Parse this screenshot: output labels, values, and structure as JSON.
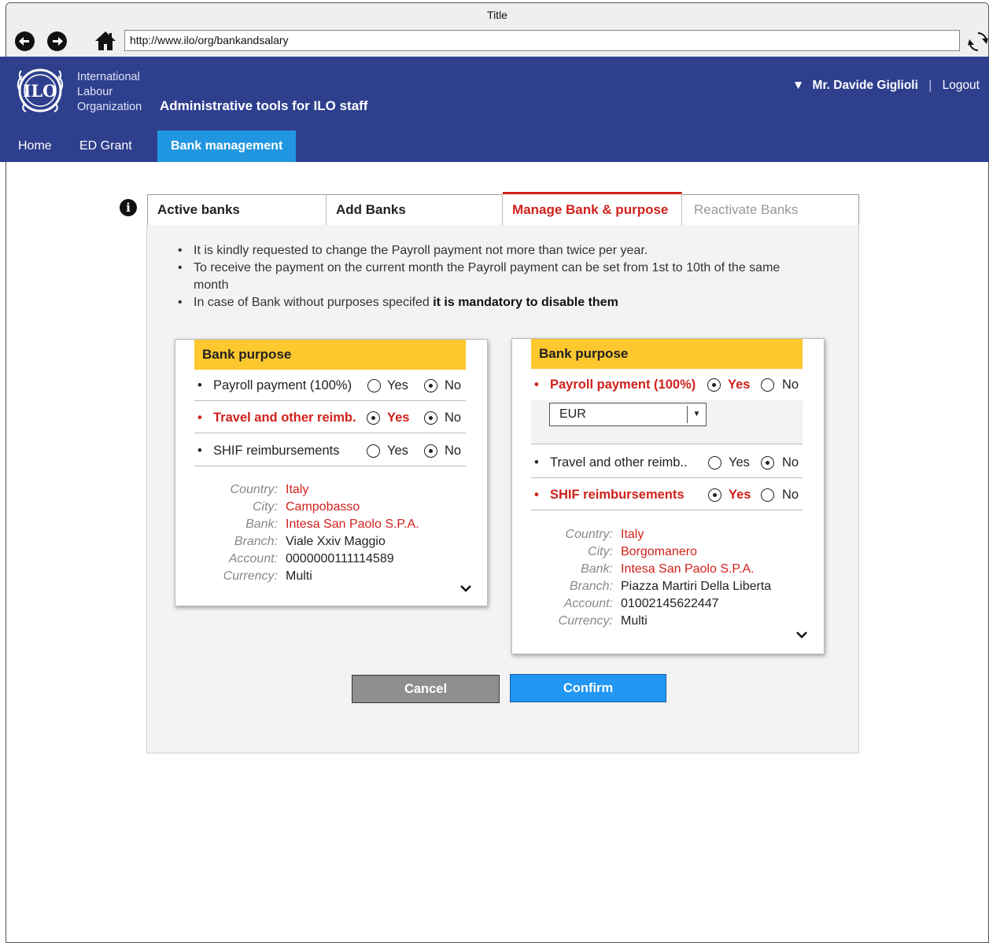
{
  "browser": {
    "title": "Title",
    "url": "http://www.ilo/org/bankandsalary"
  },
  "header": {
    "org_line1": "International",
    "org_line2": "Labour",
    "org_line3": "Organization",
    "app_title": "Administrative tools for ILO staff",
    "user_caret": "▼",
    "user_name": "Mr. Davide Giglioli",
    "separator": "|",
    "logout": "Logout"
  },
  "menu": {
    "home": "Home",
    "ed_grant": "ED Grant",
    "bank_management": "Bank management"
  },
  "tabs": {
    "active_banks": "Active banks",
    "add_banks": "Add Banks",
    "manage": "Manage Bank & purpose",
    "reactivate": "Reactivate Banks"
  },
  "notes": {
    "n1": "It is kindly requested to change the Payroll payment not more than twice per year.",
    "n2": "To receive the payment on the current month the Payroll payment can be set from 1st to 10th of the same month",
    "n3_prefix": "In case of Bank without purposes specifed ",
    "n3_strong": "it is mandatory to disable them"
  },
  "left_card": {
    "head": "Bank purpose",
    "rows": [
      {
        "label": "Payroll payment (100%)",
        "yes": "Yes",
        "no": "No",
        "selected": "no"
      },
      {
        "label": "Travel and other reimb.",
        "yes": "Yes",
        "no": "No",
        "selected": "yes"
      },
      {
        "label": "SHIF reimbursements",
        "yes": "Yes",
        "no": "No",
        "selected": "no"
      }
    ],
    "details": {
      "country_label": "Country:",
      "country": "Italy",
      "city_label": "City:",
      "city": "Campobasso",
      "bank_label": "Bank:",
      "bank": "Intesa San Paolo S.P.A.",
      "branch_label": "Branch:",
      "branch": "Viale Xxiv Maggio",
      "account_label": "Account:",
      "account": "0000000111114589",
      "currency_label": "Currency:",
      "currency": "Multi"
    }
  },
  "right_card": {
    "head": "Bank purpose",
    "rows": [
      {
        "label": "Payroll payment (100%)",
        "yes": "Yes",
        "no": "No",
        "selected": "yes"
      },
      {
        "label": "Travel and other reimb..",
        "yes": "Yes",
        "no": "No",
        "selected": "no"
      },
      {
        "label": "SHIF reimbursements",
        "yes": "Yes",
        "no": "No",
        "selected": "yes"
      }
    ],
    "currency_select": "EUR",
    "details": {
      "country_label": "Country:",
      "country": "Italy",
      "city_label": "City:",
      "city": "Borgomanero",
      "bank_label": "Bank:",
      "bank": "Intesa San Paolo S.P.A.",
      "branch_label": "Branch:",
      "branch": "Piazza Martiri Della Liberta",
      "account_label": "Account:",
      "account": "01002145622447",
      "currency_label": "Currency:",
      "currency": "Multi"
    }
  },
  "buttons": {
    "cancel": "Cancel",
    "confirm": "Confirm"
  },
  "colors": {
    "header_blue": "#2e3f8e",
    "active_blue": "#2196e0",
    "alert_red": "#d0211c",
    "purpose_yellow": "#fdc72e"
  }
}
